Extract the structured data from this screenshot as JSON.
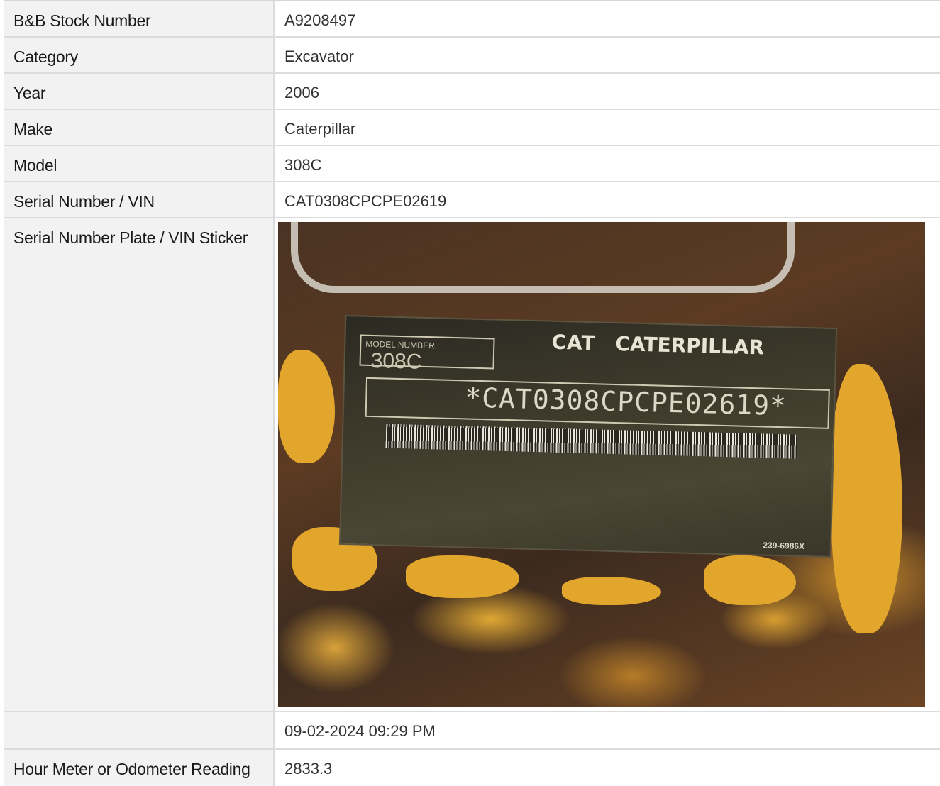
{
  "rows": [
    {
      "label": "B&B Stock Number",
      "value": "A9208497"
    },
    {
      "label": "Category",
      "value": "Excavator"
    },
    {
      "label": "Year",
      "value": "2006"
    },
    {
      "label": "Make",
      "value": "Caterpillar"
    },
    {
      "label": "Model",
      "value": "308C"
    },
    {
      "label": "Serial Number / VIN",
      "value": "CAT0308CPCPE02619"
    }
  ],
  "photo_row": {
    "label": "Serial Number Plate / VIN Sticker",
    "image_alt": "Caterpillar serial number plate on rusted yellow metal",
    "plate": {
      "model_label": "MODEL NUMBER",
      "model_value": "308C",
      "brand_short": "CAT",
      "brand_long": "CATERPILLAR",
      "serial_text": "*CAT0308CPCPE02619*",
      "part_code": "239-6986X"
    }
  },
  "timestamp_row": {
    "label": "",
    "value": "09-02-2024 09:29 PM"
  },
  "meter_row": {
    "label": "Hour Meter or Odometer Reading",
    "value": "2833.3"
  }
}
